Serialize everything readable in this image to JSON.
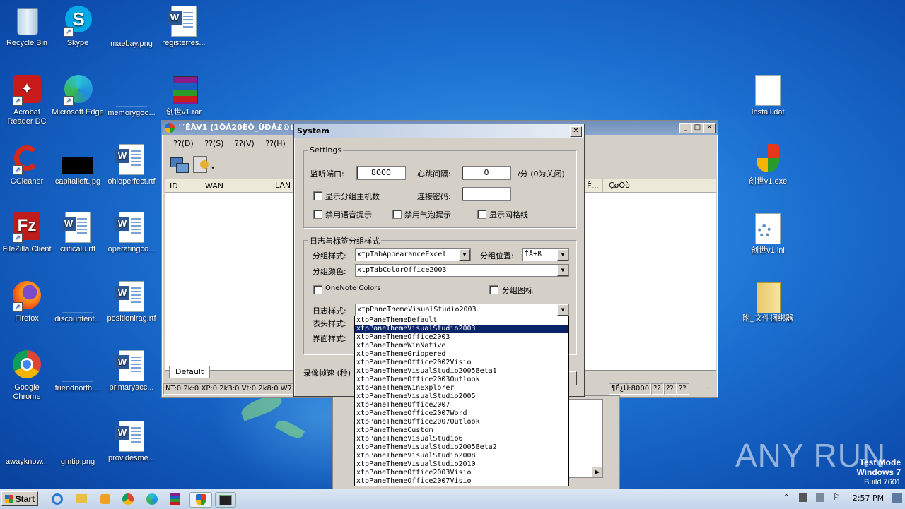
{
  "desktop": {
    "icons": [
      {
        "label": "Recycle Bin"
      },
      {
        "label": "Skype"
      },
      {
        "label": "maebay.png"
      },
      {
        "label": "registerres..."
      },
      {
        "label": "Acrobat Reader DC"
      },
      {
        "label": "Microsoft Edge"
      },
      {
        "label": "memorygoo..."
      },
      {
        "label": "创世v1.rar"
      },
      {
        "label": "CCleaner"
      },
      {
        "label": "capitalleft.jpg"
      },
      {
        "label": "ohioperfect.rtf"
      },
      {
        "label": "FileZilla Client"
      },
      {
        "label": "criticalu.rtf"
      },
      {
        "label": "operatingco..."
      },
      {
        "label": "Firefox"
      },
      {
        "label": "discountent..."
      },
      {
        "label": "positionirag.rtf"
      },
      {
        "label": "Google Chrome"
      },
      {
        "label": "friendnorth...."
      },
      {
        "label": "primaryacc..."
      },
      {
        "label": "awayknow..."
      },
      {
        "label": "gmtip.png"
      },
      {
        "label": "providesme..."
      },
      {
        "label": "Install.dat"
      },
      {
        "label": "创世v1.exe"
      },
      {
        "label": "创世v1.ini"
      },
      {
        "label": "附_文件捆绑器"
      }
    ]
  },
  "main_window": {
    "title": "´´ÊÀV1 (1ÔÂ20ÈÕ_ÙÐÂ£©tgo",
    "menu": [
      "??(D)",
      "??(S)",
      "??(V)",
      "??(H)"
    ],
    "columns": [
      "ID",
      "WAN",
      "LAN",
      "Ê...",
      "ÇøÓò"
    ],
    "tab": "Default",
    "status_left": "NT:0 2k:0 XP:0 2k3:0 Vt:0 2k8:0 W7:0",
    "status_port": "¶Ë¿Ú:8000",
    "status_q1": "??",
    "status_q2": "??",
    "status_q3": "??"
  },
  "dialog": {
    "title": "System",
    "close": "✕",
    "settings": {
      "legend": "Settings",
      "listen_port_label": "监听端口:",
      "listen_port_value": "8000",
      "heartbeat_label": "心跳间隔:",
      "heartbeat_value": "0",
      "heartbeat_unit": "/分 (0为关闭)",
      "show_group_hosts": "显示分组主机数",
      "conn_password_label": "连接密码:",
      "conn_password_value": "",
      "disable_voice": "禁用语音提示",
      "disable_bubble": "禁用气泡提示",
      "show_grid": "显示网格线"
    },
    "style_group": {
      "legend": "日志与标签分组样式",
      "group_style_label": "分组样式:",
      "group_style_value": "xtpTabAppearanceExcel",
      "group_pos_label": "分组位置:",
      "group_pos_value": "ÎÂ±ß",
      "group_color_label": "分组颜色:",
      "group_color_value": "xtpTabColorOffice2003",
      "onenote_colors": "OneNote Colors",
      "group_icon": "分组图标",
      "log_style_label": "日志样式:",
      "log_style_value": "xtpPaneThemeVisualStudio2003",
      "header_style_label": "表头样式:",
      "ui_style_label": "界面样式:"
    },
    "record_fps_label": "录像帧速 (秒)"
  },
  "dropdown": {
    "selected_index": 1,
    "options": [
      "xtpPaneThemeDefault",
      "xtpPaneThemeVisualStudio2003",
      "xtpPaneThemeOffice2003",
      "xtpPaneThemeWinNative",
      "xtpPaneThemeGrippered",
      "xtpPaneThemeOffice2002Visio",
      "xtpPaneThemeVisualStudio2005Beta1",
      "xtpPaneThemeOffice2003Outlook",
      "xtpPaneThemeWinExplorer",
      "xtpPaneThemeVisualStudio2005",
      "xtpPaneThemeOffice2007",
      "xtpPaneThemeOffice2007Word",
      "xtpPaneThemeOffice2007Outlook",
      "xtpPaneThemeCustom",
      "xtpPaneThemeVisualStudio6",
      "xtpPaneThemeVisualStudio2005Beta2",
      "xtpPaneThemeVisualStudio2008",
      "xtpPaneThemeVisualStudio2010",
      "xtpPaneThemeOffice2003Visio",
      "xtpPaneThemeOffice2007Visio"
    ]
  },
  "watermark": {
    "brand": "ANY RUN",
    "line1": "Test Mode",
    "line2": "Windows 7",
    "line3": "Build 7601"
  },
  "taskbar": {
    "start_label": "Start",
    "clock": "2:57 PM"
  }
}
